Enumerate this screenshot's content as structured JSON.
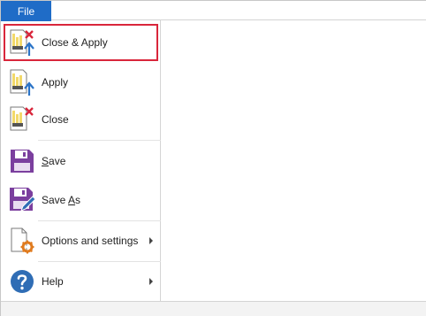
{
  "topbar": {
    "file_tab": "File"
  },
  "menu": {
    "items": [
      {
        "id": "close-apply",
        "label": "Close & Apply",
        "icon": "close-apply-icon"
      },
      {
        "id": "apply",
        "label": "Apply",
        "icon": "apply-icon"
      },
      {
        "id": "close",
        "label": "Close",
        "icon": "close-doc-icon"
      },
      {
        "id": "save",
        "label_pre": "",
        "label_u": "S",
        "label_post": "ave",
        "icon": "save-icon"
      },
      {
        "id": "save-as",
        "label_pre": "Save ",
        "label_u": "A",
        "label_post": "s",
        "icon": "save-as-icon"
      },
      {
        "id": "options",
        "label": "Options and settings",
        "icon": "options-gear-icon"
      },
      {
        "id": "help",
        "label": "Help",
        "icon": "help-icon"
      }
    ]
  },
  "colors": {
    "file_tab_bg": "#1f6cc7",
    "highlight_border": "#d9263b",
    "save_purple": "#7b3f9e",
    "help_blue": "#2f6db5",
    "gear_orange": "#e07b1f",
    "x_red": "#d9263b",
    "arrow_blue": "#2b74c7"
  }
}
